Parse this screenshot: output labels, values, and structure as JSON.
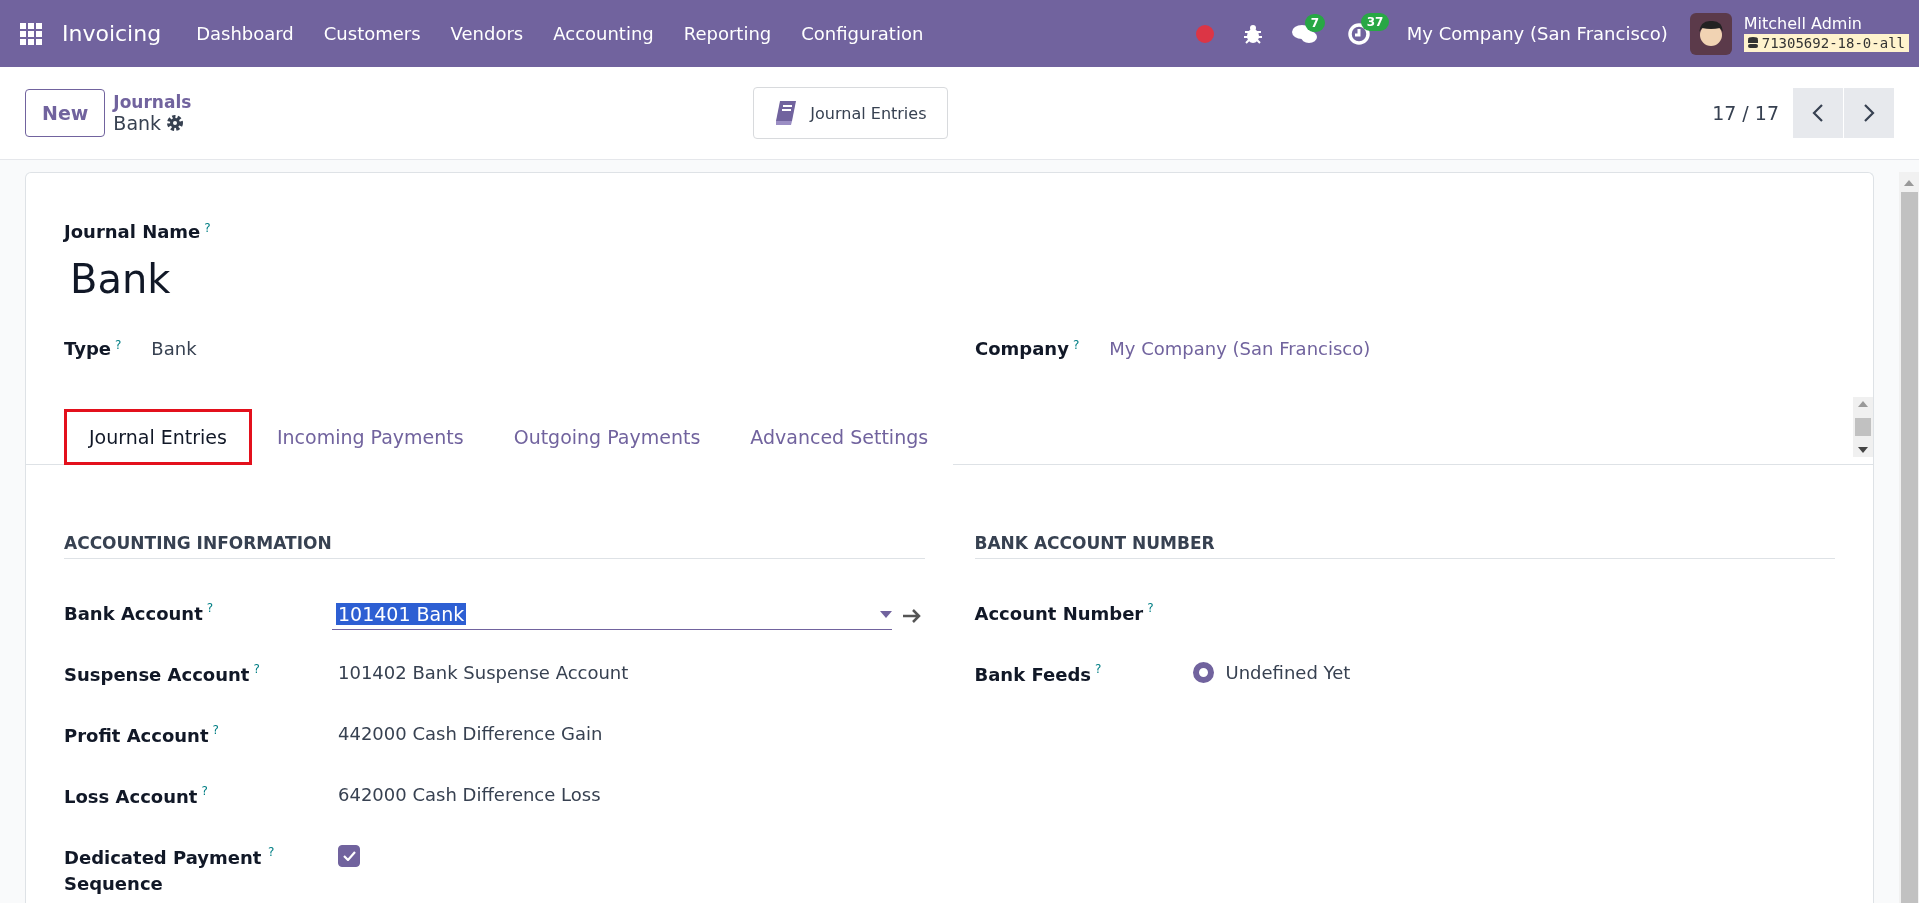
{
  "navbar": {
    "app_name": "Invoicing",
    "menu": [
      "Dashboard",
      "Customers",
      "Vendors",
      "Accounting",
      "Reporting",
      "Configuration"
    ],
    "messages_count": "7",
    "activities_count": "37",
    "company": "My Company (San Francisco)",
    "user": "Mitchell Admin",
    "database": "71305692-18-0-all"
  },
  "control_panel": {
    "new_button": "New",
    "breadcrumb": "Journals",
    "record": "Bank",
    "smart_button": "Journal Entries",
    "pager": "17 / 17"
  },
  "form": {
    "journal_name_label": "Journal Name",
    "journal_name_help": "?",
    "journal_name": "Bank",
    "type_label": "Type",
    "type_help": "?",
    "type": "Bank",
    "company_label": "Company",
    "company_help": "?",
    "company": "My Company (San Francisco)",
    "tabs": [
      {
        "label": "Journal Entries",
        "selected": true,
        "highlighted": true
      },
      {
        "label": "Incoming Payments",
        "selected": false,
        "highlighted": false
      },
      {
        "label": "Outgoing Payments",
        "selected": false,
        "highlighted": false
      },
      {
        "label": "Advanced Settings",
        "selected": false,
        "highlighted": false
      }
    ],
    "accounting_information": {
      "title": "ACCOUNTING INFORMATION",
      "fields": [
        {
          "kind": "select",
          "label": "Bank Account",
          "help": "?",
          "value": "101401 Bank"
        },
        {
          "kind": "text",
          "label": "Suspense Account",
          "help": "?",
          "value": "101402 Bank Suspense Account"
        },
        {
          "kind": "text",
          "label": "Profit Account",
          "help": "?",
          "value": "442000 Cash Difference Gain"
        },
        {
          "kind": "text",
          "label": "Loss Account",
          "help": "?",
          "value": "642000 Cash Difference Loss"
        },
        {
          "kind": "checkbox",
          "label": "Dedicated Payment Sequence",
          "help": "?",
          "checked": true
        }
      ]
    },
    "bank_account_number": {
      "title": "BANK ACCOUNT NUMBER",
      "fields": [
        {
          "kind": "text",
          "label": "Account Number",
          "help": "?"
        },
        {
          "kind": "radio",
          "label": "Bank Feeds",
          "help": "?",
          "value": "Undefined Yet",
          "selected": true
        }
      ]
    }
  }
}
